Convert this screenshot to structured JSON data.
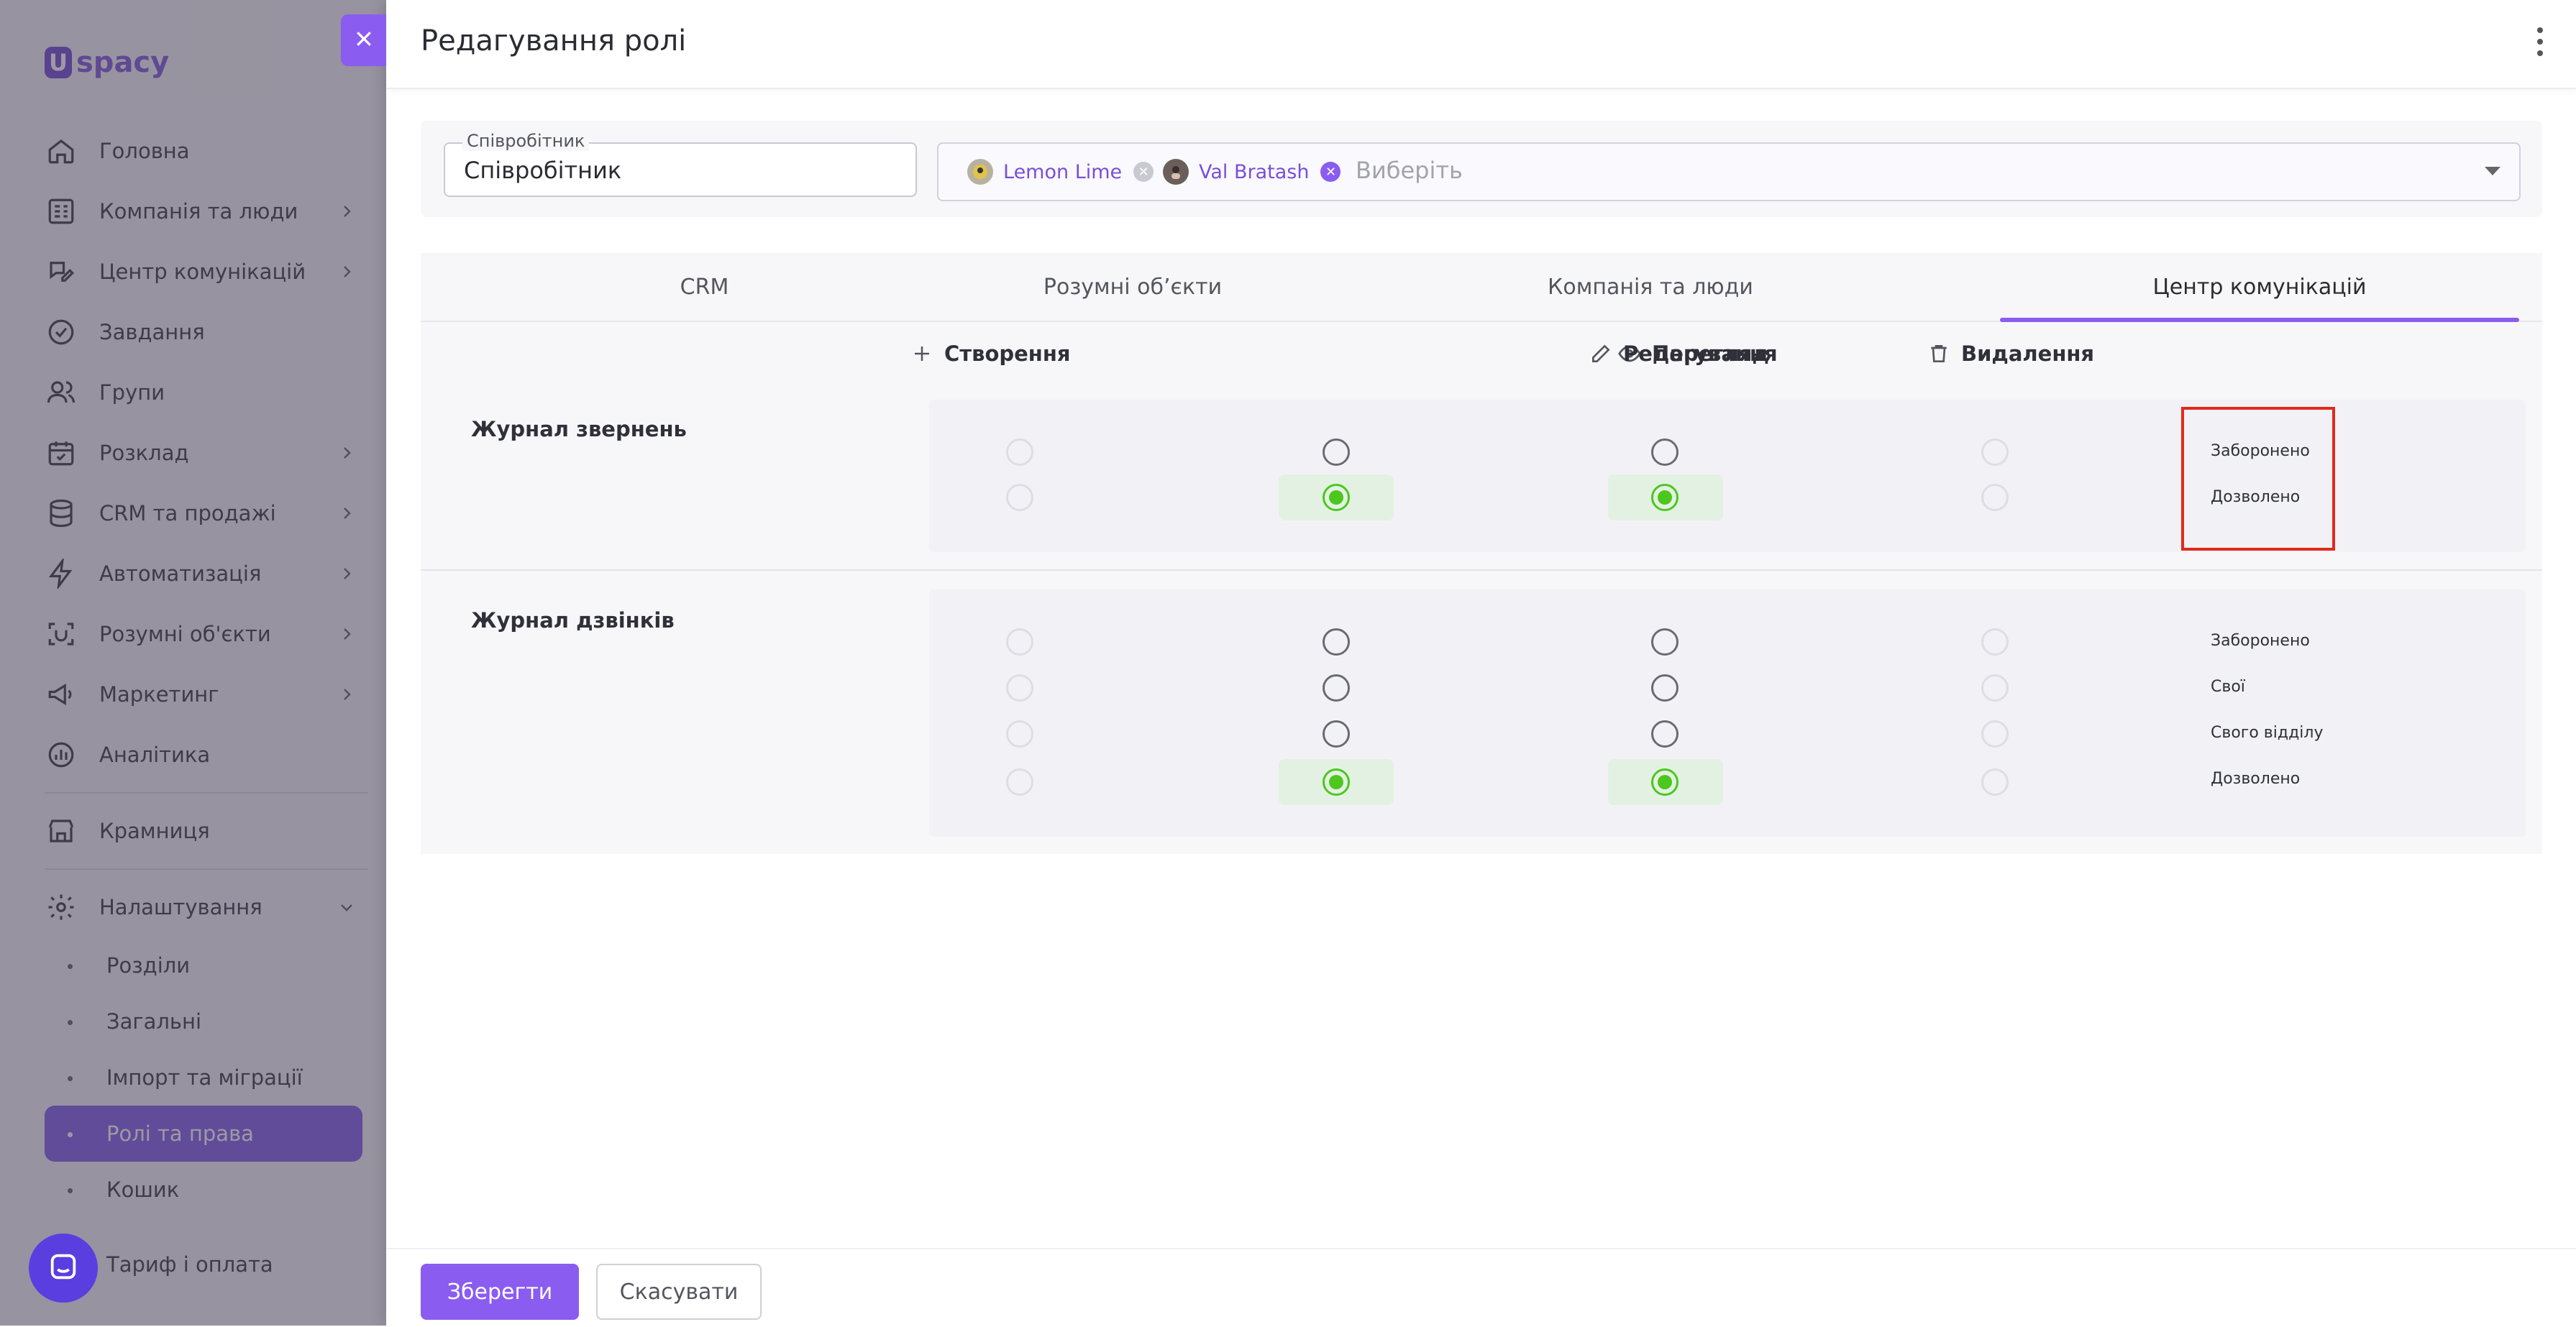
{
  "sidebar": {
    "logo_text": "spacy",
    "logo_mark": "U",
    "items": [
      {
        "label": "Головна",
        "icon": "home-icon",
        "chevron": false
      },
      {
        "label": "Компанія та люди",
        "icon": "building-icon",
        "chevron": true
      },
      {
        "label": "Центр комунікацій",
        "icon": "chat-edit-icon",
        "chevron": true
      },
      {
        "label": "Завдання",
        "icon": "check-circle-icon",
        "chevron": false
      },
      {
        "label": "Групи",
        "icon": "users-icon",
        "chevron": false
      },
      {
        "label": "Розклад",
        "icon": "calendar-icon",
        "chevron": true
      },
      {
        "label": "CRM та продажі",
        "icon": "database-icon",
        "chevron": true
      },
      {
        "label": "Автоматизація",
        "icon": "lightning-icon",
        "chevron": true
      },
      {
        "label": "Розумні об'єкти",
        "icon": "smart-object-icon",
        "chevron": true
      },
      {
        "label": "Маркетинг",
        "icon": "megaphone-icon",
        "chevron": true
      },
      {
        "label": "Аналітика",
        "icon": "chart-icon",
        "chevron": false
      }
    ],
    "shop_label": "Крамниця",
    "settings_label": "Налаштування",
    "sub_items": [
      "Розділи",
      "Загальні",
      "Імпорт та міграції",
      "Ролі та права",
      "Кошик"
    ],
    "active_sub_index": 3,
    "tariff_label": "Тариф і оплата"
  },
  "panel": {
    "title": "Редагування ролі",
    "role_field": {
      "floating_label": "Співробітник",
      "value": "Співробітник"
    },
    "users_field": {
      "chips": [
        {
          "name": "Lemon Lime"
        },
        {
          "name": "Val Bratash"
        }
      ],
      "placeholder": "Виберіть"
    }
  },
  "tabs": [
    {
      "label": "CRM",
      "active": false
    },
    {
      "label": "Розумні обʼєкти",
      "active": false
    },
    {
      "label": "Компанія та люди",
      "active": false
    },
    {
      "label": "Центр комунікацій",
      "active": true
    }
  ],
  "columns": [
    {
      "label": "Створення",
      "icon": "plus-icon"
    },
    {
      "label": "Перегляд",
      "icon": "eye-icon"
    },
    {
      "label": "Редагування",
      "icon": "pencil-icon"
    },
    {
      "label": "Видалення",
      "icon": "trash-icon"
    }
  ],
  "sections": [
    {
      "title": "Журнал звернень",
      "options": [
        "Заборонено",
        "Дозволено"
      ],
      "selected": {
        "create": null,
        "view": 1,
        "edit": 1,
        "delete": null
      }
    },
    {
      "title": "Журнал дзвінків",
      "options": [
        "Заборонено",
        "Свої",
        "Свого відділу",
        "Дозволено"
      ],
      "selected": {
        "create": null,
        "view": 3,
        "edit": 3,
        "delete": null
      }
    }
  ],
  "footer": {
    "save_label": "Зберегти",
    "cancel_label": "Скасувати"
  },
  "colors": {
    "accent": "#8a5cf0",
    "selected_green": "#4cc71d",
    "highlight_red": "#e02a1c"
  }
}
